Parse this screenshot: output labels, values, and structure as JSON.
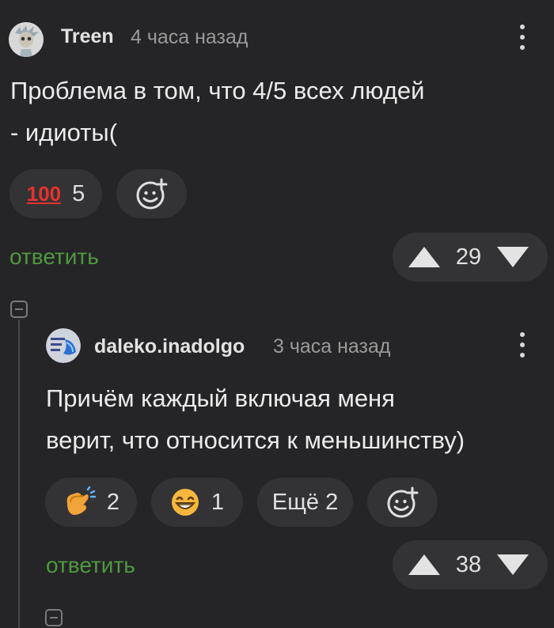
{
  "comment1": {
    "author": "Treen",
    "time": "4 часа назад",
    "text_line1": "Проблема в том, что 4/5 всех людей",
    "text_line2": "- идиоты(",
    "reactions": [
      {
        "icon": "hundred-points-icon",
        "emoji": "💯",
        "count": "5"
      }
    ],
    "add_reaction_icon": "add-reaction-icon",
    "reply_label": "ответить",
    "score": "29"
  },
  "comment2": {
    "author": "daleko.inadolgo",
    "time": "3 часа назад",
    "text_line1": "Причём каждый включая меня",
    "text_line2": "верит, что относится к меньшинству)",
    "reactions": [
      {
        "icon": "clapping-hands-icon",
        "emoji": "👏",
        "count": "2"
      },
      {
        "icon": "smiling-face-icon",
        "emoji": "😆",
        "count": "1"
      }
    ],
    "more_reactions": "Ещё 2",
    "add_reaction_icon": "add-reaction-icon",
    "reply_label": "ответить",
    "score": "38"
  },
  "colors": {
    "background": "#252527",
    "pill": "#333336",
    "reply": "#4f9a3f",
    "muted": "#9a9a9a"
  }
}
